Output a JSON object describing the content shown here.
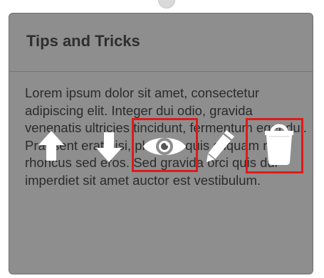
{
  "card": {
    "title": "Tips and Tricks",
    "body": "Lorem ipsum dolor sit amet, consectetur adipiscing elit. Integer dui odio, gravida venenatis ultricies tincidunt, fermentum eget dui. Praesent erat nisi, placerat quis aliquam non, rhoncus sed eros. Sed gravida orci quis dui imperdiet sit amet auctor est vestibulum."
  },
  "toolbar": {
    "icons": [
      "arrow-up-icon",
      "arrow-down-icon",
      "eye-icon",
      "pencil-icon",
      "trash-icon"
    ],
    "icon_color": "#ffffff",
    "highlight_color": "#e01a1a"
  },
  "colors": {
    "card_background": "#8e8e8e",
    "title_color": "#2e2e2e",
    "text_color": "#2b2b2b"
  }
}
